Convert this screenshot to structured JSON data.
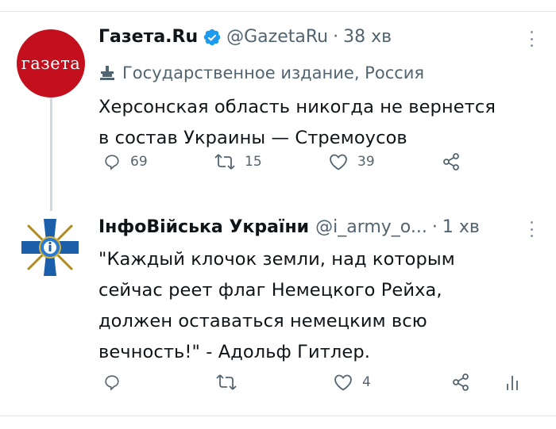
{
  "tweets": [
    {
      "name": "Газета.Ru",
      "handle": "@GazetaRu",
      "separator": "·",
      "time": "38 хв",
      "avatar_text": "газета",
      "label": "Государственное издание, Россия",
      "text": "Херсонская область никогда не вернется\nв состав Украины — Стремоусов",
      "actions": {
        "replies": "69",
        "retweets": "15",
        "likes": "39"
      },
      "colors": {
        "avatar_bg": "#c4101e"
      }
    },
    {
      "name": "ІнфоВійська України",
      "handle": "@i_army_o...",
      "separator": "·",
      "time": "1 хв",
      "text": "\"Каждый клочок земли, над которым\nсейчас реет флаг Немецкого Рейха,\nдолжен оставаться немецким всю\nвечность!\" - Адольф Гитлер.",
      "actions": {
        "replies": "",
        "retweets": "",
        "likes": "4"
      }
    }
  ],
  "colors": {
    "verified": "#1d9bf0",
    "secondary_text": "#536471",
    "divider": "#e6e9ec"
  },
  "icons": [
    "verified-badge-icon",
    "more-icon",
    "state-media-icon",
    "reply-icon",
    "retweet-icon",
    "like-icon",
    "share-icon",
    "analytics-icon"
  ]
}
